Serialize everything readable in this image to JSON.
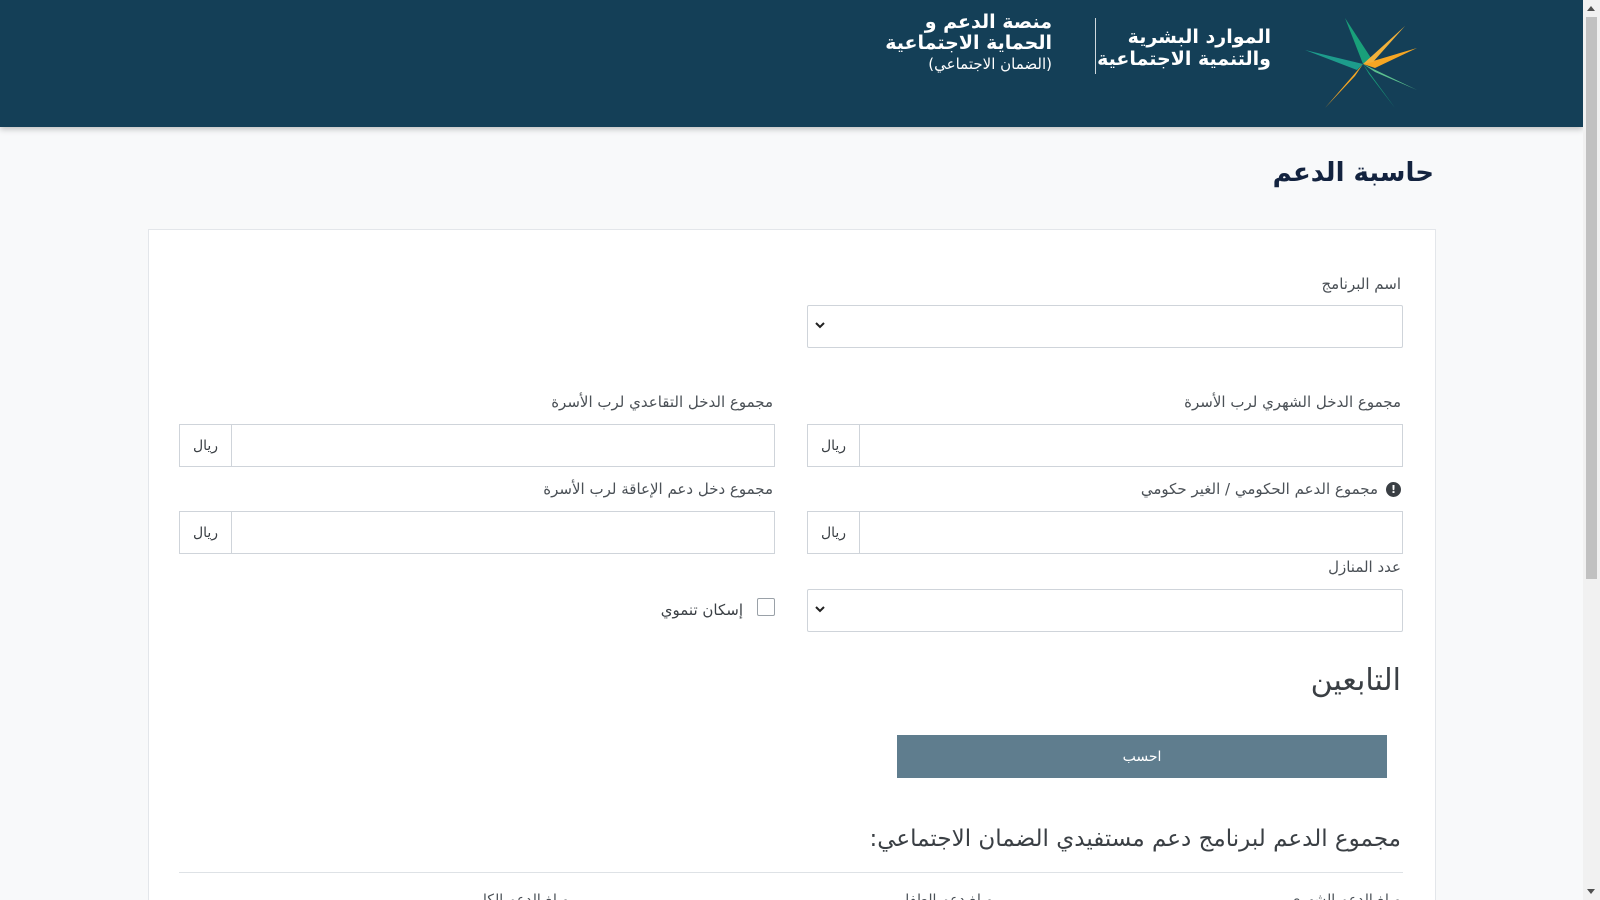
{
  "header": {
    "ministry_line1": "الموارد البشرية",
    "ministry_line2": "والتنمية الاجتماعية",
    "platform_line1": "منصة الدعم و",
    "platform_line2": "الحماية الاجتماعية",
    "platform_line3": "(الضمان الاجتماعي)",
    "logo_icon": "ministry-logo-icon",
    "bg_color": "#143f57"
  },
  "page": {
    "title": "حاسبة الدعم"
  },
  "form": {
    "program_label": "اسم البرنامج",
    "monthly_income_label": "مجموع الدخل الشهري لرب الأسرة",
    "retirement_income_label": "مجموع الدخل التقاعدي لرب الأسرة",
    "gov_support_label": "مجموع الدعم الحكومي / الغير حكومي",
    "disability_income_label": "مجموع دخل دعم الإعاقة لرب الأسرة",
    "currency": "ريال",
    "houses_label": "عدد المنازل",
    "housing_checkbox_label": "إسكان تنموي",
    "dependents_title": "التابعين",
    "calculate_button": "احسب",
    "button_color": "#5f7d8e"
  },
  "results": {
    "title": "مجموع الدعم لبرنامج دعم مستفيدي الضمان الاجتماعي:",
    "col1": "مبلغ الدعم الشهري",
    "col2": "مبلغ دعم الطفل",
    "col3": "مبلغ الدعم الكلي"
  }
}
